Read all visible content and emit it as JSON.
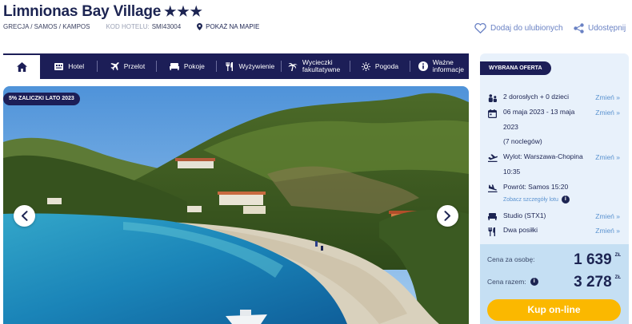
{
  "hotel": {
    "name": "Limnionas Bay Village",
    "stars": "★★★",
    "location": "GRECJA / SAMOS / KAMPOS",
    "code_label": "KOD HOTELU:",
    "code_value": "SMI43004",
    "map_link": "POKAŻ NA MAPIE"
  },
  "actions": {
    "favorite": "Dodaj do ulubionych",
    "share": "Udostępnij"
  },
  "nav": {
    "items": [
      {
        "label": "Hotel",
        "icon": "hotel-icon"
      },
      {
        "label": "Przelot",
        "icon": "plane-icon"
      },
      {
        "label": "Pokoje",
        "icon": "bed-icon"
      },
      {
        "label": "Wyżywienie",
        "icon": "cutlery-icon"
      },
      {
        "label_line1": "Wycieczki",
        "label_line2": "fakultatywne",
        "icon": "palm-icon"
      },
      {
        "label": "Pogoda",
        "icon": "sun-icon"
      },
      {
        "label_line1": "Ważne",
        "label_line2": "informacje",
        "icon": "info-icon"
      }
    ]
  },
  "gallery": {
    "promo_badge": "5% ZALICZKI LATO 2023"
  },
  "offer": {
    "badge": "WYBRANA OFERTA",
    "change_label": "Zmień »",
    "travelers": "2 dorosłych + 0 dzieci",
    "dates_line1": "06 maja 2023 - 13 maja",
    "dates_line2": "2023",
    "dates_line3": "(7 noclegów)",
    "departure_line1": "Wylot: Warszawa-Chopina",
    "departure_line2": "10:35",
    "return": "Powrót: Samos 15:20",
    "flight_details": "Zobacz szczegóły lotu",
    "room": "Studio (STX1)",
    "board": "Dwa posiłki",
    "price_per_person_label": "Cena za osobę:",
    "price_per_person": "1 639",
    "price_total_label": "Cena razem:",
    "price_total": "3 278",
    "currency": "ZŁ",
    "buy_button": "Kup on-line"
  },
  "colors": {
    "navy": "#1c1e57",
    "accent_link": "#5b93d0",
    "buy_button": "#fbb800",
    "panel_bg": "#e8f1fb",
    "price_bg": "#c5dff3"
  }
}
